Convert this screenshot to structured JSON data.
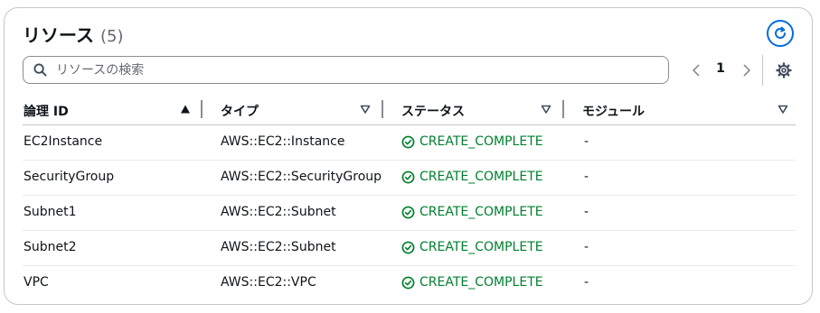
{
  "header": {
    "title": "リソース",
    "count": "(5)"
  },
  "search": {
    "placeholder": "リソースの検索",
    "value": ""
  },
  "pagination": {
    "current_page": "1"
  },
  "columns": [
    {
      "label": "論理 ID",
      "sort": "ascending"
    },
    {
      "label": "タイプ",
      "sort": "none"
    },
    {
      "label": "ステータス",
      "sort": "none"
    },
    {
      "label": "モジュール",
      "sort": "none"
    }
  ],
  "rows": [
    {
      "logical_id": "EC2Instance",
      "type": "AWS::EC2::Instance",
      "status": "CREATE_COMPLETE",
      "module": "-"
    },
    {
      "logical_id": "SecurityGroup",
      "type": "AWS::EC2::SecurityGroup",
      "status": "CREATE_COMPLETE",
      "module": "-"
    },
    {
      "logical_id": "Subnet1",
      "type": "AWS::EC2::Subnet",
      "status": "CREATE_COMPLETE",
      "module": "-"
    },
    {
      "logical_id": "Subnet2",
      "type": "AWS::EC2::Subnet",
      "status": "CREATE_COMPLETE",
      "module": "-"
    },
    {
      "logical_id": "VPC",
      "type": "AWS::EC2::VPC",
      "status": "CREATE_COMPLETE",
      "module": "-"
    }
  ],
  "icons": {
    "refresh": "refresh-icon",
    "search": "search-icon",
    "prev": "chevron-left-icon",
    "next": "chevron-right-icon",
    "settings": "gear-icon",
    "sort_asc": "sort-ascending-icon",
    "sort_none": "sort-descending-outline-icon",
    "status_ok": "check-circle-icon"
  },
  "colors": {
    "accent": "#006ce0",
    "success": "#00802f",
    "border": "#c6c6cd",
    "text": "#0f141a",
    "muted": "#656871"
  }
}
